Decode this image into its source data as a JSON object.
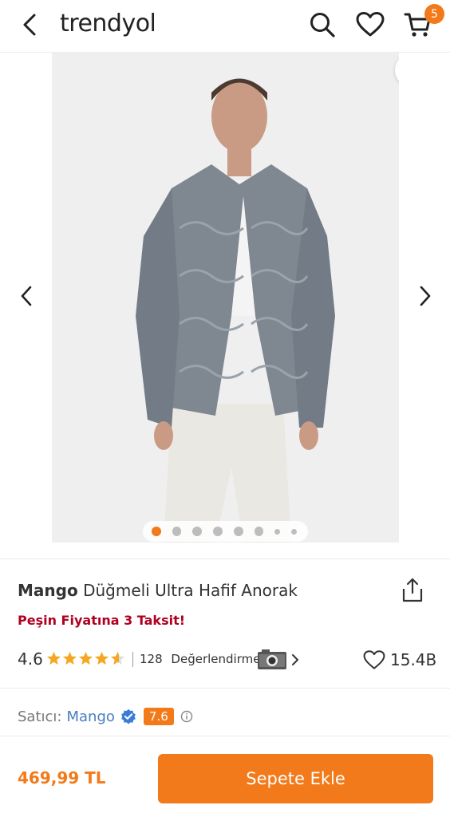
{
  "header": {
    "logo": "trendyol",
    "cart_count": "5"
  },
  "gallery": {
    "image_count": 8,
    "active_index": 0
  },
  "product": {
    "brand": "Mango",
    "name": "Düğmeli Ultra Hafif Anorak",
    "installment_text": "Peşin Fiyatına 3 Taksit!",
    "rating": "4.6",
    "rating_value": 4.6,
    "review_count": "128",
    "reviews_label": "Değerlendirme",
    "favorites": "15.4B"
  },
  "seller": {
    "label": "Satıcı:",
    "name": "Mango",
    "score": "7.6"
  },
  "bottom_bar": {
    "price": "469,99 TL",
    "add_to_cart": "Sepete Ekle"
  },
  "colors": {
    "accent": "#f27a1a",
    "installment": "#b00020",
    "seller_link": "#4a7dc0"
  },
  "icons": [
    "back-arrow-icon",
    "search-icon",
    "heart-icon",
    "cart-icon",
    "share-icon",
    "star-icon",
    "camera-icon",
    "chevron-right-icon",
    "verified-icon",
    "info-icon"
  ]
}
